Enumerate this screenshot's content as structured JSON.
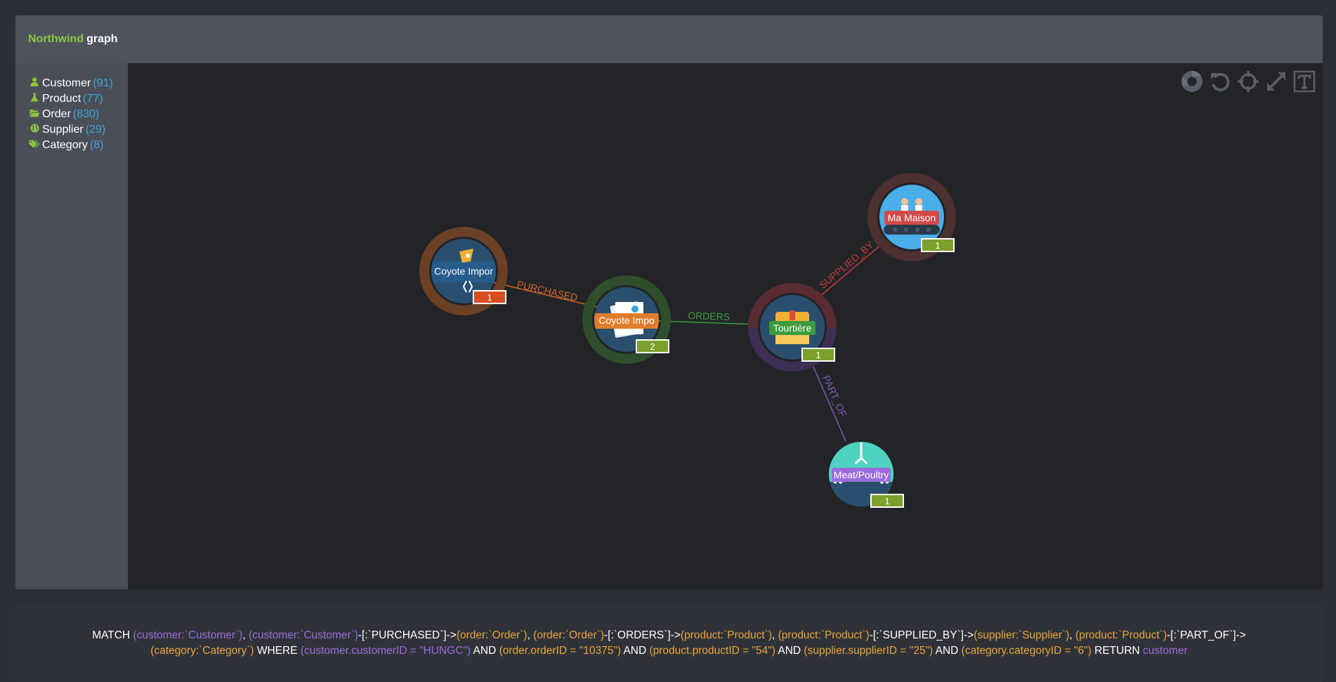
{
  "brand": {
    "name_accent": "Northwind",
    "name_rest": "graph"
  },
  "legend": [
    {
      "icon": "user-icon",
      "label": "Customer",
      "count": "(91)"
    },
    {
      "icon": "flask-icon",
      "label": "Product",
      "count": "(77)"
    },
    {
      "icon": "folder-open-icon",
      "label": "Order",
      "count": "(830)"
    },
    {
      "icon": "globe-icon",
      "label": "Supplier",
      "count": "(29)"
    },
    {
      "icon": "tags-icon",
      "label": "Category",
      "count": "(8)"
    }
  ],
  "toolbar": [
    "chrome-icon",
    "undo-icon",
    "crosshairs-icon",
    "expand-icon",
    "text-icon"
  ],
  "graph": {
    "nodes": [
      {
        "id": "customer",
        "label": "Coyote Impor",
        "badge": "1",
        "ring": "#6b4025",
        "fill": "#2a4f6e",
        "labelBg": "#275b8a",
        "badgeColor": "#d94e1f"
      },
      {
        "id": "order",
        "label": "Coyote Impo",
        "badge": "2",
        "ring": "#2f4e2c",
        "fill": "#2a4f6e",
        "labelBg": "#e07d2c",
        "badgeColor": "#7ba02b"
      },
      {
        "id": "product",
        "label": "Tourtière",
        "badge": "1",
        "ring": "#5b2b34",
        "fill": "#2a4f6e",
        "labelBg": "#3d9a3d",
        "badgeColor": "#7ba02b"
      },
      {
        "id": "supplier",
        "label": "Ma Maison",
        "badge": "1",
        "ring": "#4d3030",
        "fill": "#4aaee8",
        "labelBg": "#d24a4a",
        "badgeColor": "#7ba02b"
      },
      {
        "id": "category",
        "label": "Meat/Poultry",
        "badge": "1",
        "ring": "#222428",
        "fill": "#4fd3c1",
        "labelBg": "#9b6cdc",
        "badgeColor": "#7ba02b"
      }
    ],
    "edges": [
      {
        "from": "customer",
        "to": "order",
        "label": "PURCHASED",
        "color": "#d4662a"
      },
      {
        "from": "order",
        "to": "product",
        "label": "ORDERS",
        "color": "#3f9b3c"
      },
      {
        "from": "product",
        "to": "supplier",
        "label": "SUPPLIED_BY",
        "color": "#c93b3b"
      },
      {
        "from": "product",
        "to": "category",
        "label": "PART_OF",
        "color": "#7e5ab8"
      }
    ]
  },
  "query": {
    "segments": [
      {
        "t": "MATCH ",
        "c": "w"
      },
      {
        "t": "(customer:`Customer`)",
        "c": "p"
      },
      {
        "t": ", ",
        "c": "w"
      },
      {
        "t": "(customer:`Customer`)",
        "c": "p"
      },
      {
        "t": "-[:`PURCHASED`]->",
        "c": "w"
      },
      {
        "t": "(order:`Order`)",
        "c": "o"
      },
      {
        "t": ", ",
        "c": "w"
      },
      {
        "t": "(order:`Order`)",
        "c": "o"
      },
      {
        "t": "-[:`ORDERS`]->",
        "c": "w"
      },
      {
        "t": "(product:`Product`)",
        "c": "o"
      },
      {
        "t": ", ",
        "c": "w"
      },
      {
        "t": "(product:`Product`)",
        "c": "o"
      },
      {
        "t": "-[:`SUPPLIED_BY`]->",
        "c": "w"
      },
      {
        "t": "(supplier:`Supplier`)",
        "c": "o"
      },
      {
        "t": ", ",
        "c": "w"
      },
      {
        "t": "(product:`Product`)",
        "c": "o"
      },
      {
        "t": "-[:`PART_OF`]-> ",
        "c": "w"
      },
      {
        "t": "(category:`Category`)",
        "c": "o"
      },
      {
        "t": " WHERE ",
        "c": "w"
      },
      {
        "t": "(customer.customerID = \"HUNGC\")",
        "c": "p"
      },
      {
        "t": " AND ",
        "c": "w"
      },
      {
        "t": "(order.orderID = \"10375\")",
        "c": "o"
      },
      {
        "t": " AND ",
        "c": "w"
      },
      {
        "t": "(product.productID = \"54\")",
        "c": "o"
      },
      {
        "t": " AND ",
        "c": "w"
      },
      {
        "t": "(supplier.supplierID = \"25\")",
        "c": "o"
      },
      {
        "t": " AND ",
        "c": "w"
      },
      {
        "t": "(category.categoryID = \"6\")",
        "c": "o"
      },
      {
        "t": " RETURN ",
        "c": "w"
      },
      {
        "t": "customer",
        "c": "p"
      }
    ]
  }
}
